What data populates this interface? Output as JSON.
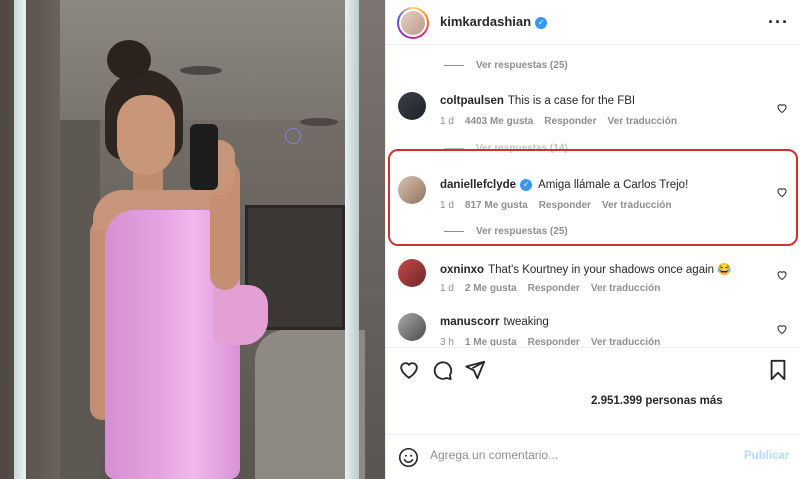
{
  "post": {
    "author": "kimkardashian",
    "verified_icon": "verified-badge-icon",
    "more_icon": "more-horizontal-icon"
  },
  "comments": {
    "top_view_replies": "Ver respuestas (25)",
    "items": [
      {
        "username": "coltpaulsen",
        "text": "This is a case for the FBI",
        "verified": false,
        "time": "1 d",
        "likes": "4403 Me gusta",
        "reply": "Responder",
        "translate": "Ver traducción",
        "replies_partial": "Ver respuestas (14)"
      },
      {
        "username": "daniellefclyde",
        "text": "Amiga llámale a Carlos Trejo!",
        "verified": true,
        "time": "1 d",
        "likes": "817 Me gusta",
        "reply": "Responder",
        "translate": "Ver traducción",
        "replies": "Ver respuestas (25)"
      },
      {
        "username": "oxninxo",
        "text": "That's Kourtney in your shadows once again 😂",
        "verified": false,
        "time": "1 d",
        "likes": "2 Me gusta",
        "reply": "Responder",
        "translate": "Ver traducción"
      },
      {
        "username": "manuscorr",
        "text": "tweaking",
        "verified": false,
        "time": "3 h",
        "likes": "1 Me gusta",
        "reply": "Responder",
        "translate": "Ver traducción"
      }
    ]
  },
  "actions": {
    "like_icon": "heart-icon",
    "comment_icon": "comment-icon",
    "share_icon": "send-icon",
    "save_icon": "bookmark-icon",
    "likes_text": "2.951.399 personas más"
  },
  "comment_bar": {
    "emoji_icon": "emoji-icon",
    "placeholder": "Agrega un comentario...",
    "publish": "Publicar"
  },
  "colors": {
    "highlight": "#d42f2f",
    "verified": "#3897f0",
    "muted": "#8e8e8e",
    "publish_disabled": "#b3dbff"
  }
}
